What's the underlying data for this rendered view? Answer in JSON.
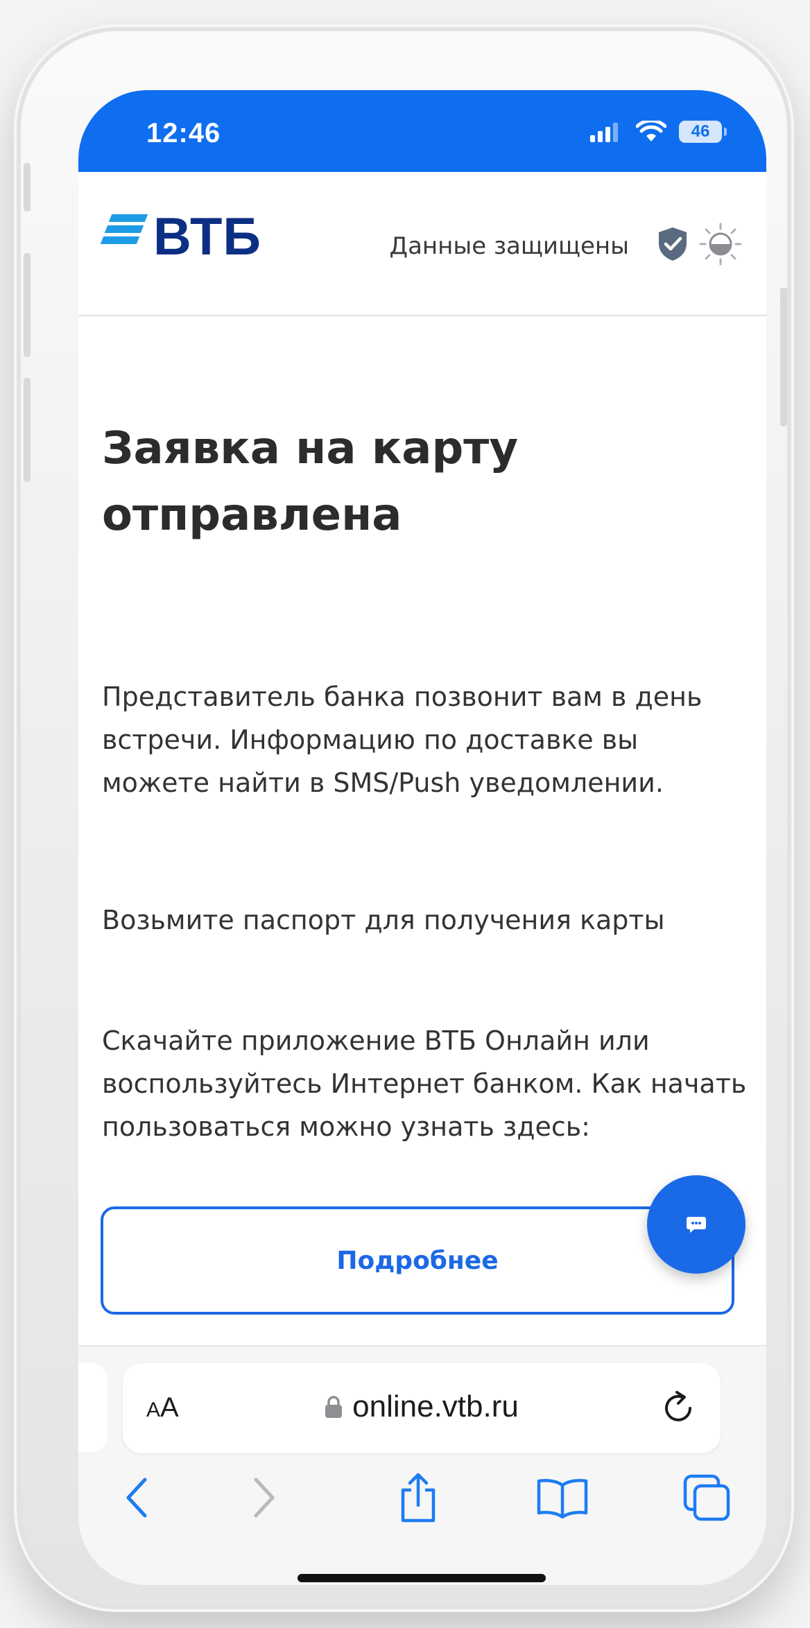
{
  "status_bar": {
    "time": "12:46",
    "battery": "46",
    "icons": [
      "signal-icon",
      "wifi-icon",
      "battery-icon"
    ]
  },
  "header": {
    "logo_text": "ВТБ",
    "secure_label": "Данные защищены",
    "icons": [
      "shield-check-icon",
      "theme-toggle-icon"
    ]
  },
  "main": {
    "title": "Заявка на карту отправлена",
    "paragraph_1": "Представитель банка позвонит вам в день встречи. Информацию по доставке вы можете найти в SMS/Push уведомлении.",
    "paragraph_2": "Возьмите паспорт для получения карты",
    "paragraph_3": "Скачайте приложение ВТБ Онлайн или воспользуйтесь Интернет банком. Как начать пользоваться можно узнать здесь:",
    "details_button": "Подробнее"
  },
  "browser": {
    "aa_small": "A",
    "aa_big": "A",
    "url": "online.vtb.ru",
    "icons": [
      "lock-icon",
      "reload-icon",
      "back-icon",
      "forward-icon",
      "share-icon",
      "bookmarks-icon",
      "tabs-icon"
    ]
  },
  "colors": {
    "brand_blue": "#0f6ef0",
    "logo_navy": "#0c2f84",
    "logo_stripes": "#1d9be6",
    "button_blue": "#1c68e6",
    "safari_blue": "#1d7cf2"
  }
}
